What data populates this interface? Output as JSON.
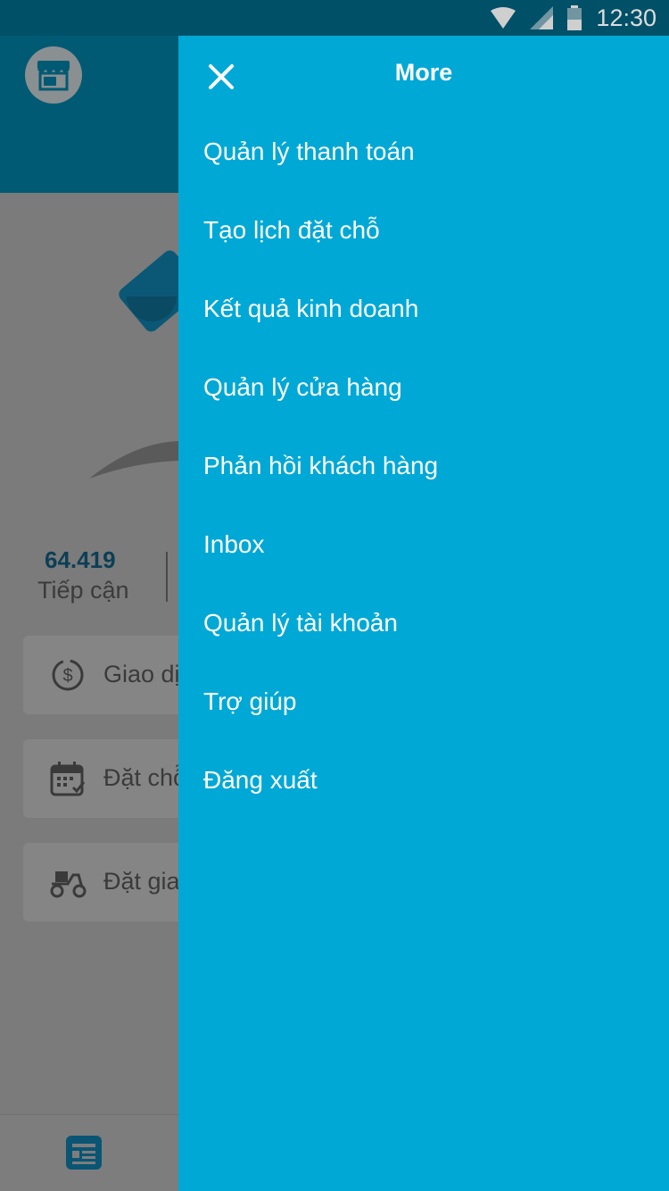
{
  "status_bar": {
    "time": "12:30",
    "icons": [
      "wifi-icon",
      "cell-signal-icon",
      "battery-icon"
    ]
  },
  "background": {
    "header_icon": "store-icon",
    "stat": {
      "value": "64.419",
      "label": "Tiếp cận"
    },
    "cards": [
      {
        "icon": "dollar-sync-icon",
        "label": "Giao dị"
      },
      {
        "icon": "calendar-icon",
        "label": "Đặt chỗ"
      },
      {
        "icon": "scooter-icon",
        "label": "Đặt gia"
      }
    ],
    "bottom_nav_icon": "newsfeed-icon"
  },
  "drawer": {
    "title": "More",
    "close_icon": "close-icon",
    "items": [
      {
        "label": "Quản lý thanh toán"
      },
      {
        "label": "Tạo lịch đặt chỗ"
      },
      {
        "label": "Kết quả kinh doanh"
      },
      {
        "label": "Quản lý cửa hàng"
      },
      {
        "label": "Phản hồi khách hàng"
      },
      {
        "label": "Inbox"
      },
      {
        "label": "Quản lý tài khoản"
      },
      {
        "label": "Trợ giúp"
      },
      {
        "label": "Đăng xuất"
      }
    ]
  },
  "colors": {
    "drawer_bg": "#00a8d6",
    "header_bg": "#005a73",
    "status_bar_bg": "#005068"
  }
}
